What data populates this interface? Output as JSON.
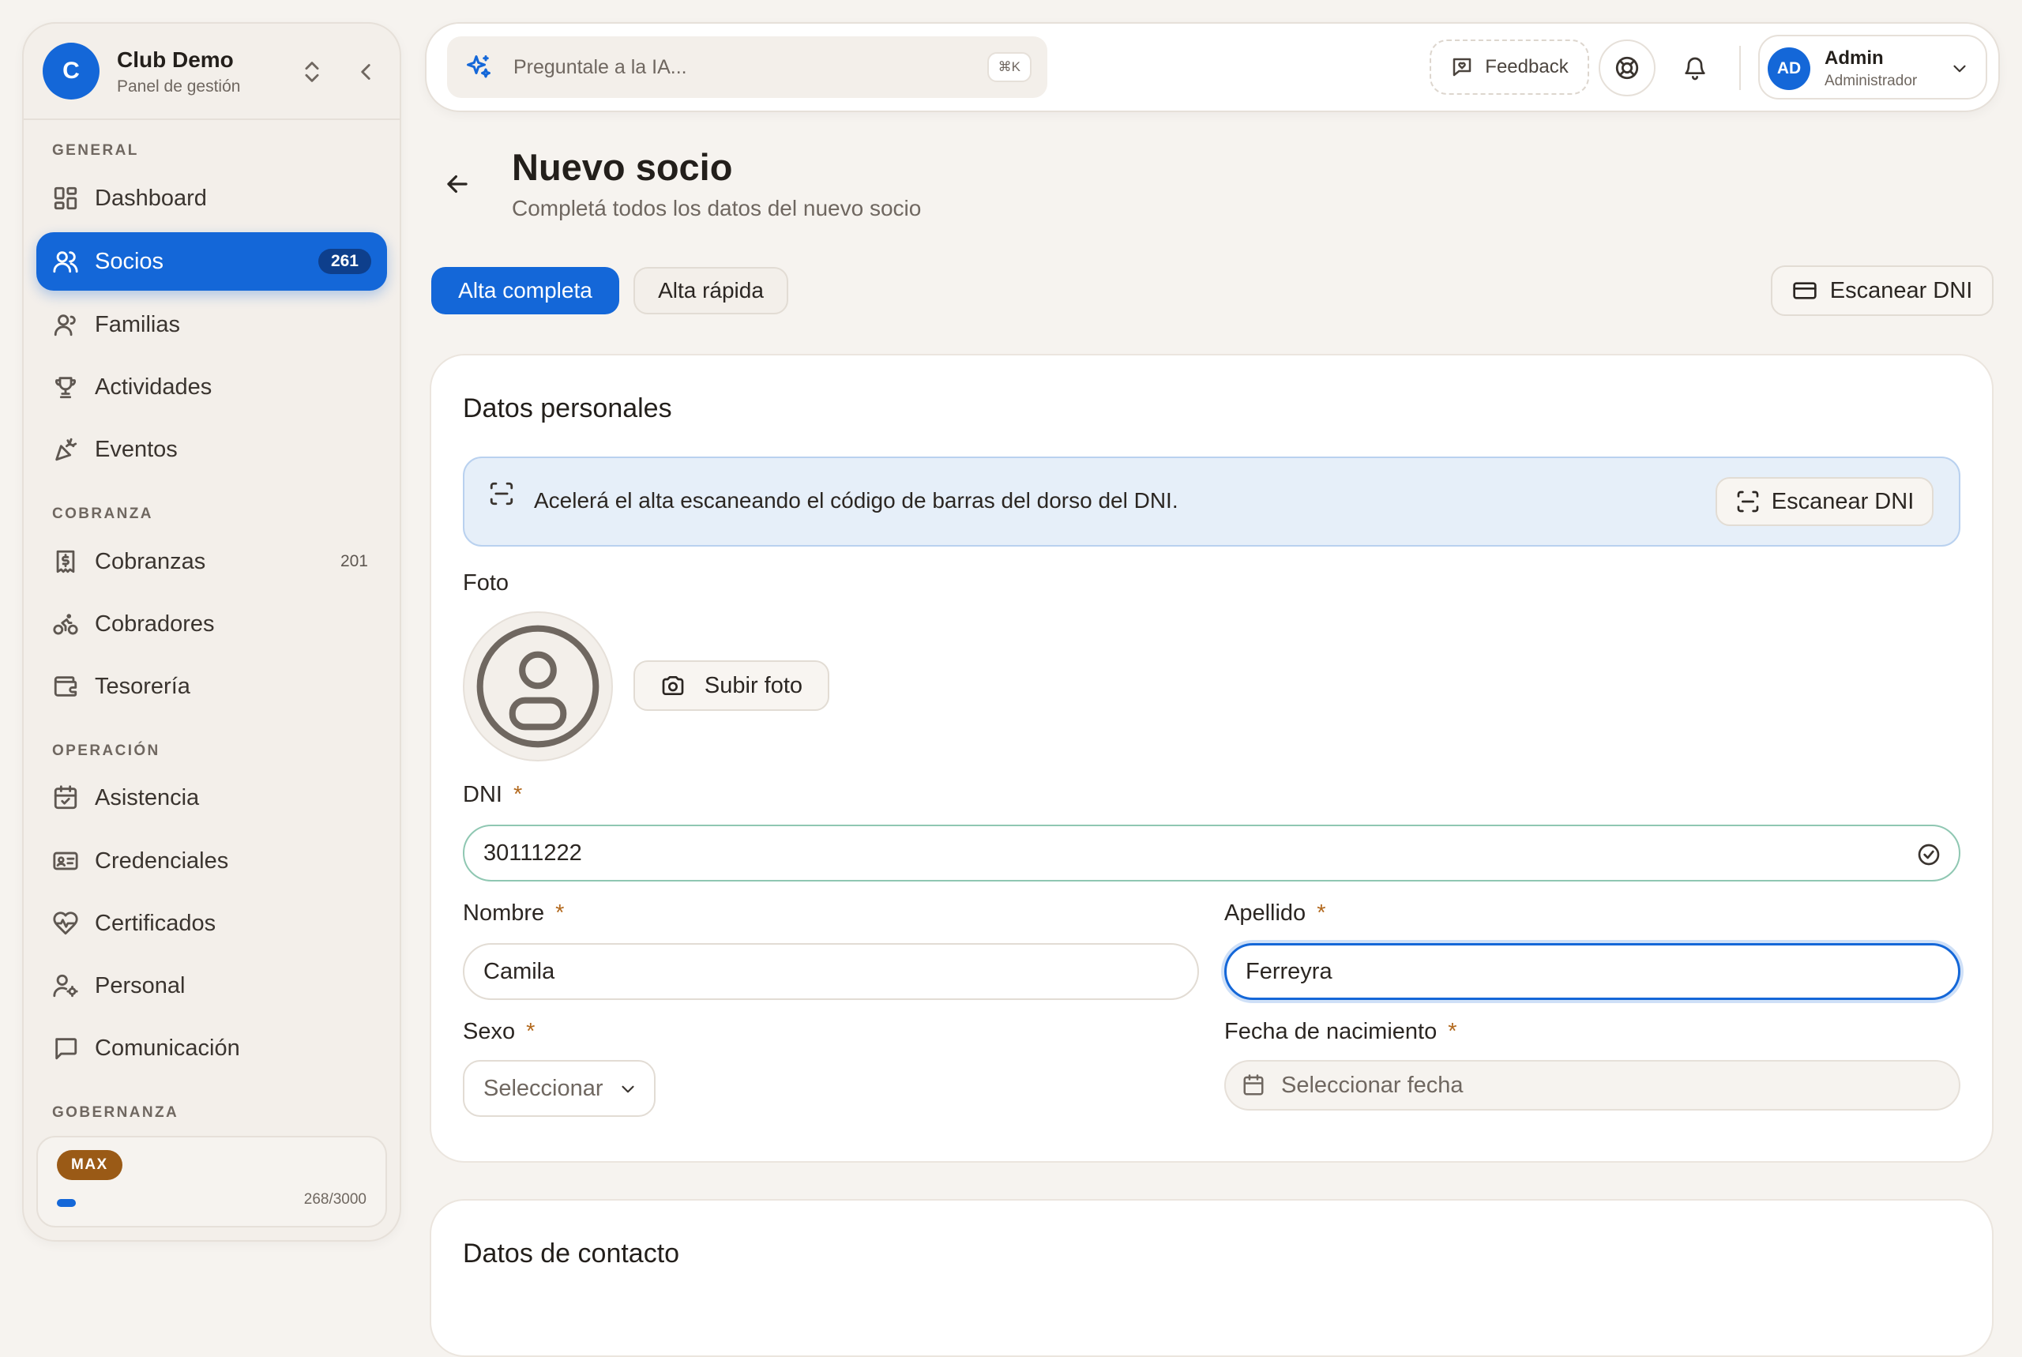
{
  "sidebar": {
    "brand": {
      "initial": "C",
      "name": "Club Demo",
      "subtitle": "Panel de gestión"
    },
    "sections": {
      "general": "GENERAL",
      "cobranza": "COBRANZA",
      "operacion": "OPERACIÓN",
      "gobernanza": "GOBERNANZA"
    },
    "items": {
      "dashboard": {
        "label": "Dashboard",
        "icon": "dashboard-icon"
      },
      "socios": {
        "label": "Socios",
        "count": "261",
        "icon": "users-icon"
      },
      "familias": {
        "label": "Familias",
        "icon": "user-icon"
      },
      "actividades": {
        "label": "Actividades",
        "icon": "trophy-icon"
      },
      "eventos": {
        "label": "Eventos",
        "icon": "party-icon"
      },
      "cobranzas": {
        "label": "Cobranzas",
        "count": "201",
        "icon": "receipt-icon"
      },
      "cobradores": {
        "label": "Cobradores",
        "icon": "bike-icon"
      },
      "tesoreria": {
        "label": "Tesorería",
        "icon": "wallet-icon"
      },
      "asistencia": {
        "label": "Asistencia",
        "icon": "calendar-check-icon"
      },
      "credenciales": {
        "label": "Credenciales",
        "icon": "id-card-icon"
      },
      "certificados": {
        "label": "Certificados",
        "icon": "heart-pulse-icon"
      },
      "personal": {
        "label": "Personal",
        "icon": "user-cog-icon"
      },
      "comunicacion": {
        "label": "Comunicación",
        "icon": "message-icon"
      }
    },
    "plan": {
      "badge": "MAX",
      "usage": "268/3000",
      "used": 268,
      "limit": 3000
    }
  },
  "topbar": {
    "ai_placeholder": "Preguntale a la IA...",
    "ai_shortcut": "⌘K",
    "feedback_label": "Feedback",
    "user": {
      "initials": "AD",
      "name": "Admin",
      "role": "Administrador"
    }
  },
  "page": {
    "title": "Nuevo socio",
    "subtitle": "Completá todos los datos del nuevo socio",
    "tabs": {
      "full": "Alta completa",
      "quick": "Alta rápida"
    },
    "scan_button": "Escanear DNI"
  },
  "form": {
    "section_title": "Datos personales",
    "banner": {
      "text": "Acelerá el alta escaneando el código de barras del dorso del DNI.",
      "button": "Escanear DNI"
    },
    "photo": {
      "label": "Foto",
      "upload_button": "Subir foto"
    },
    "dni": {
      "label": "DNI",
      "required": "*",
      "value": "30111222"
    },
    "nombre": {
      "label": "Nombre",
      "required": "*",
      "value": "Camila"
    },
    "apellido": {
      "label": "Apellido",
      "required": "*",
      "value": "Ferreyra"
    },
    "sexo": {
      "label": "Sexo",
      "required": "*",
      "placeholder": "Seleccionar"
    },
    "fecha": {
      "label": "Fecha de nacimiento",
      "required": "*",
      "placeholder": "Seleccionar fecha"
    },
    "next_section_title": "Datos de contacto"
  },
  "colors": {
    "accent": "#1467d8",
    "plan_badge": "#9a5a16",
    "required": "#b36a1f",
    "background": "#f6f3ef"
  }
}
